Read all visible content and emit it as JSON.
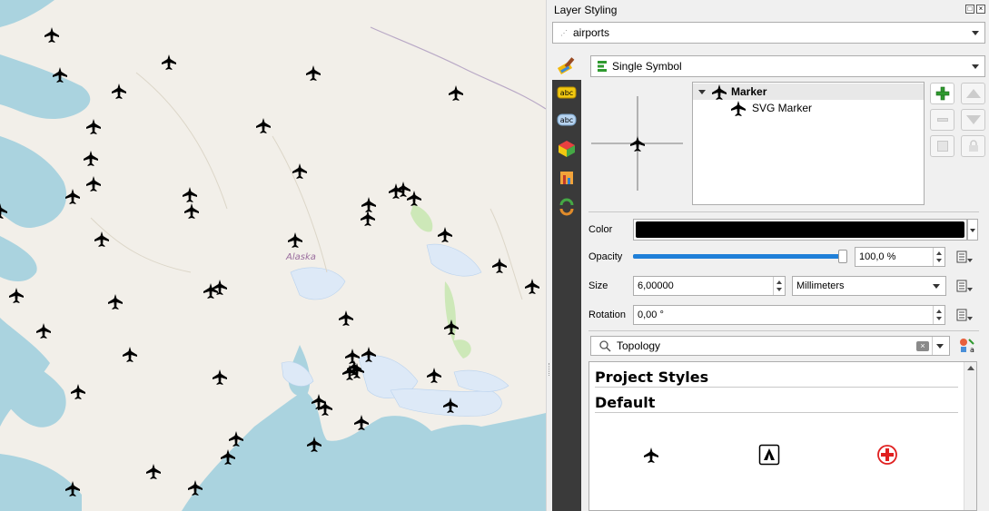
{
  "map": {
    "country_label": "Alaska",
    "airports_count": 75
  },
  "panel": {
    "title": "Layer Styling",
    "layer_combo": {
      "value": "airports",
      "icon": "point-layer-icon"
    },
    "renderer_combo": {
      "value": "Single Symbol",
      "icon": "single-symbol-icon"
    },
    "side_tabs": [
      {
        "name": "symbology-tab-icon"
      },
      {
        "name": "labels-tab-icon"
      },
      {
        "name": "masks-tab-icon"
      },
      {
        "name": "3d-view-tab-icon"
      },
      {
        "name": "diagrams-tab-icon"
      },
      {
        "name": "history-tab-icon"
      }
    ],
    "symbol_tree": {
      "root": "Marker",
      "child": "SVG Marker"
    },
    "properties": {
      "color_label": "Color",
      "color_value": "#000000",
      "opacity_label": "Opacity",
      "opacity_value": "100,0 %",
      "opacity_fraction": 1.0,
      "size_label": "Size",
      "size_value": "6,00000",
      "size_unit": "Millimeters",
      "rotation_label": "Rotation",
      "rotation_value": "0,00 °"
    },
    "style_search": {
      "value": "Topology"
    },
    "style_sections": {
      "project": "Project Styles",
      "default": "Default"
    },
    "accent": "#1f7fd8"
  }
}
